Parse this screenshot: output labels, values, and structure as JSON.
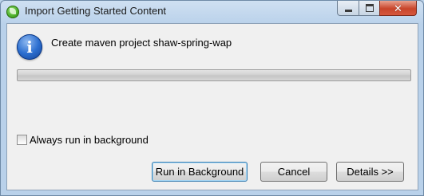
{
  "window": {
    "title": "Import Getting Started Content",
    "app_icon": "spring-leaf-icon",
    "controls": {
      "minimize_icon": "minimize-icon",
      "maximize_icon": "maximize-icon",
      "close_icon": "close-icon",
      "close_glyph": "✕"
    }
  },
  "dialog": {
    "info_icon": "info-icon",
    "info_glyph": "i",
    "message": "Create maven project shaw-spring-wap",
    "progress": 0.0,
    "checkbox": {
      "label": "Always run in background",
      "checked": false
    },
    "buttons": {
      "run_in_background": "Run in Background",
      "cancel": "Cancel",
      "details": "Details >>"
    }
  },
  "colors": {
    "title_bar": "#b9d1ea",
    "close_button": "#c8452b",
    "info_icon": "#2c6fd0",
    "default_button_border": "#3c7fb1"
  }
}
